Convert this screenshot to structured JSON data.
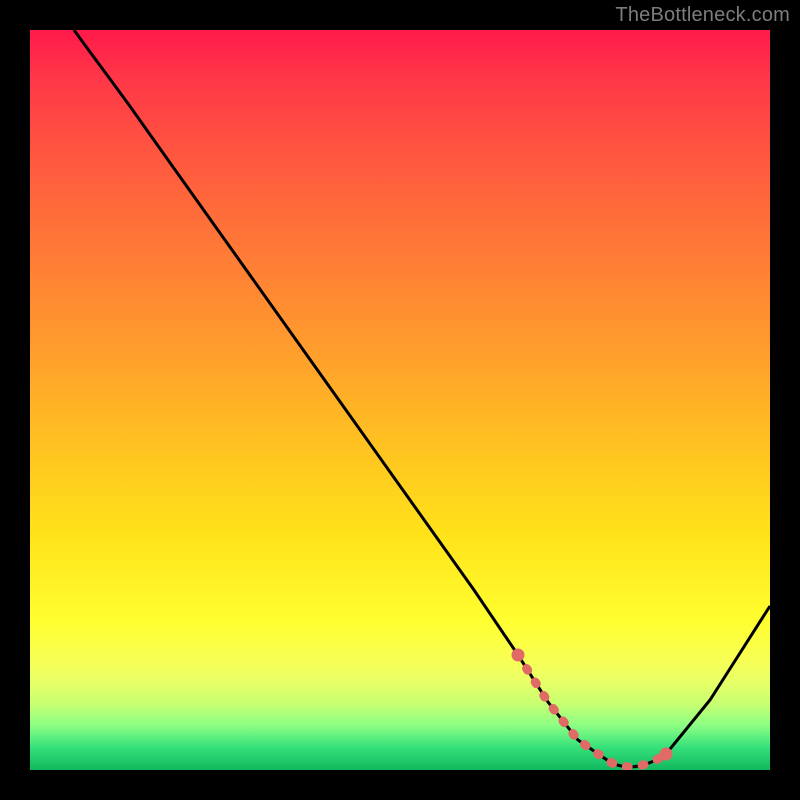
{
  "watermark": "TheBottleneck.com",
  "chart_data": {
    "type": "line",
    "title": "",
    "xlabel": "",
    "ylabel": "",
    "xlim": [
      0,
      100
    ],
    "ylim": [
      0,
      100
    ],
    "background_gradient": {
      "top": "#ff1a4b",
      "bottom": "#11b85e",
      "meaning": "red-high-bottleneck, green-low-bottleneck"
    },
    "series": [
      {
        "name": "bottleneck-curve",
        "color": "#000000",
        "x": [
          6,
          10,
          14,
          20,
          30,
          40,
          50,
          60,
          66,
          70,
          74,
          78,
          82,
          86,
          100
        ],
        "y": [
          100,
          96,
          92,
          84,
          70,
          56,
          42,
          28,
          19,
          12,
          6,
          2,
          1,
          2,
          24
        ]
      },
      {
        "name": "optimal-range-highlight",
        "color": "#e06a65",
        "x": [
          66,
          70,
          74,
          78,
          82,
          86
        ],
        "y": [
          19,
          12,
          6,
          2,
          1,
          2
        ]
      }
    ],
    "annotations": []
  }
}
